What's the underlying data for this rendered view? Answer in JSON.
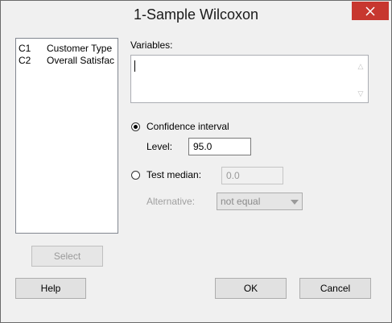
{
  "window": {
    "title": "1-Sample Wilcoxon"
  },
  "variables_list": [
    {
      "column": "C1",
      "name": "Customer Type"
    },
    {
      "column": "C2",
      "name": "Overall Satisfac"
    }
  ],
  "form": {
    "variables_label": "Variables:",
    "variables_value": "",
    "confidence_interval_label": "Confidence interval",
    "level_label": "Level:",
    "level_value": "95.0",
    "test_median_label": "Test median:",
    "test_median_value": "0.0",
    "alternative_label": "Alternative:",
    "alternative_value": "not equal",
    "selected_option": "confidence_interval"
  },
  "buttons": {
    "select": "Select",
    "help": "Help",
    "ok": "OK",
    "cancel": "Cancel"
  },
  "icons": {
    "close": "close-icon",
    "scroll_up": "scroll-up-icon",
    "scroll_down": "scroll-down-icon",
    "dropdown": "chevron-down-icon"
  },
  "colors": {
    "close_button": "#c7372f",
    "window_bg": "#f0f0f0"
  }
}
